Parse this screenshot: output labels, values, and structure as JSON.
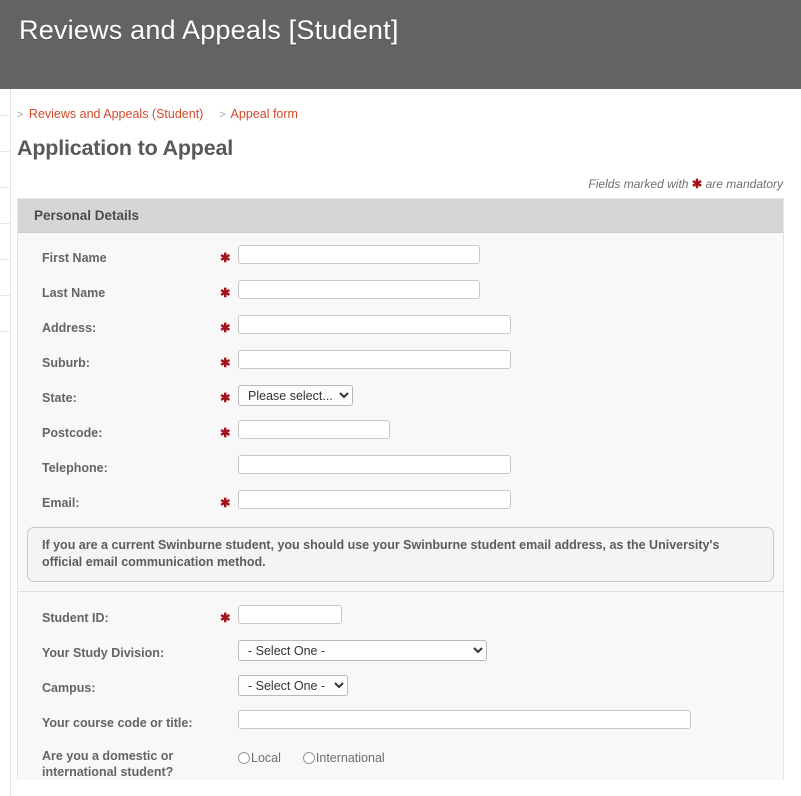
{
  "banner": {
    "title": "Reviews and Appeals [Student]"
  },
  "breadcrumb": {
    "sep": ">",
    "items": [
      {
        "label": "Reviews and Appeals (Student)"
      },
      {
        "label": "Appeal form"
      }
    ]
  },
  "page": {
    "title": "Application to Appeal",
    "mandatory_note_before": "Fields marked with",
    "mandatory_marker": "✱",
    "mandatory_note_after": "are mandatory"
  },
  "personal_details": {
    "section_title": "Personal Details",
    "fields": [
      {
        "label": "First Name",
        "required": true,
        "type": "text",
        "value": ""
      },
      {
        "label": "Last Name",
        "required": true,
        "type": "text",
        "value": ""
      },
      {
        "label": "Address:",
        "required": true,
        "type": "text",
        "value": ""
      },
      {
        "label": "Suburb:",
        "required": true,
        "type": "text",
        "value": ""
      },
      {
        "label": "State:",
        "required": true,
        "type": "select",
        "value": "Please select..."
      },
      {
        "label": "Postcode:",
        "required": true,
        "type": "text",
        "value": ""
      },
      {
        "label": "Telephone:",
        "required": false,
        "type": "text",
        "value": ""
      },
      {
        "label": "Email:",
        "required": true,
        "type": "text",
        "value": ""
      }
    ]
  },
  "email_notice": {
    "text": "If you are a current Swinburne student, you should use your Swinburne student email address, as the University's official email communication method."
  },
  "study_details": {
    "student_id": {
      "label": "Student ID:",
      "value": ""
    },
    "study_division": {
      "label": "Your Study Division:",
      "value": "- Select One -"
    },
    "campus": {
      "label": "Campus:",
      "value": "- Select One -"
    },
    "course_code": {
      "label": "Your course code or title:",
      "value": ""
    },
    "student_type": {
      "label": "Are you a domestic or international student?",
      "options": [
        {
          "label": "Local",
          "checked": false
        },
        {
          "label": "International",
          "checked": false
        }
      ]
    }
  },
  "colors": {
    "banner": "#636363",
    "accent_link": "#d2492a",
    "required": "#a4121c",
    "section_header": "#d8d5d5",
    "panel_bg": "#f8f8f8"
  }
}
